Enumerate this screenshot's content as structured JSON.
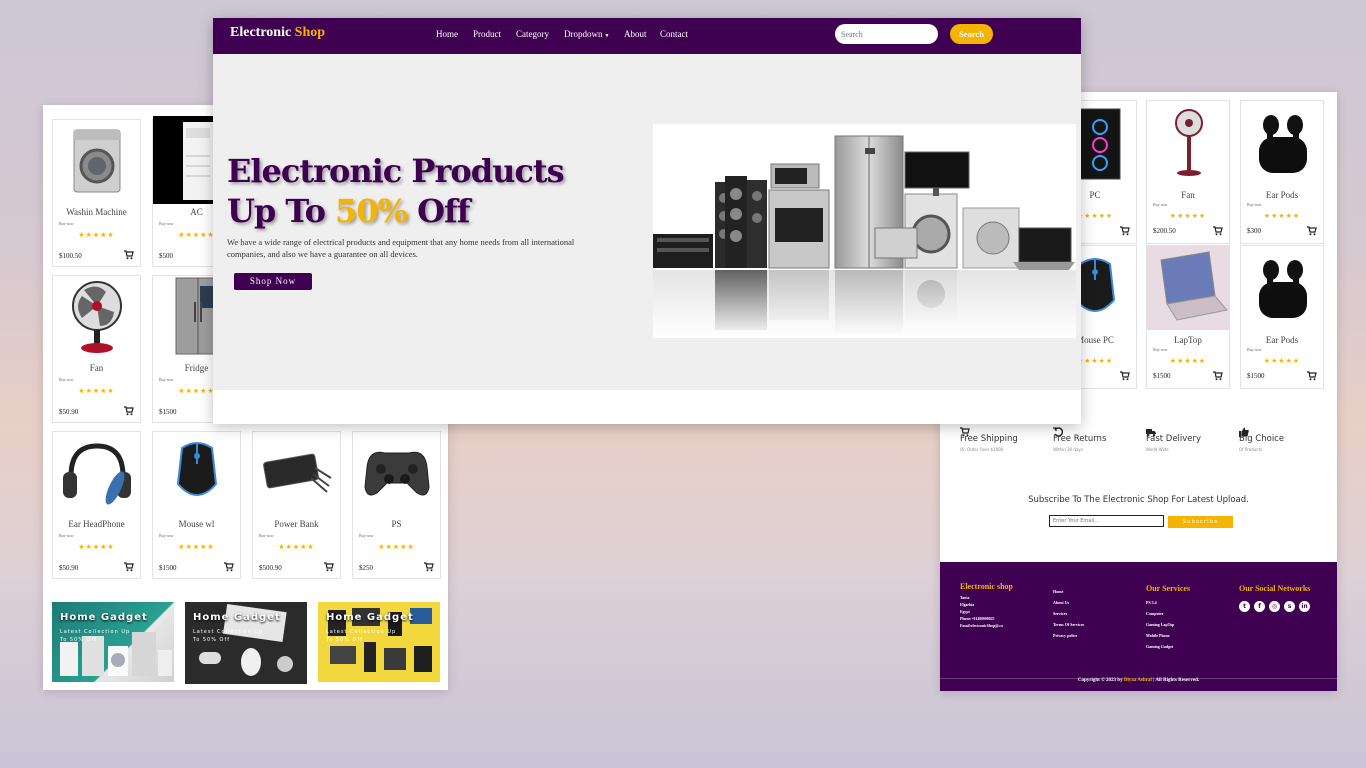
{
  "brand": {
    "first": "Electronic",
    "second": "Shop"
  },
  "nav": {
    "links": [
      "Home",
      "Product",
      "Category",
      "Dropdown",
      "About",
      "Contact"
    ],
    "search_placeholder": "Search",
    "search_button": "Search"
  },
  "hero": {
    "title_line1": "Electronic Products",
    "title_line2_prefix": "Up To",
    "title_line2_highlight": "50%",
    "title_line2_suffix": "Off",
    "description": "We have a wide range of electrical products and equipment that any home needs from all international companies, and also we have a guarantee on all devices.",
    "cta": "Shop Now"
  },
  "left_products": [
    {
      "name": "Washin Machine",
      "buy": "Buy now",
      "stars": "★★★★★",
      "price": "$100.50",
      "icon": "washing-machine"
    },
    {
      "name": "AC",
      "buy": "Buy now",
      "stars": "★★★★★",
      "price": "$500",
      "icon": "air-conditioner"
    },
    {
      "name": "Fan",
      "buy": "Buy now",
      "stars": "★★★★★",
      "price": "$50.90",
      "icon": "fan"
    },
    {
      "name": "Fridge",
      "buy": "Buy now",
      "stars": "★★★★★",
      "price": "$1500",
      "icon": "fridge"
    },
    {
      "name": "Ear HeadPhone",
      "buy": "Buy now",
      "stars": "★★★★★",
      "price": "$50.90",
      "icon": "headphones"
    },
    {
      "name": "Mouse wl",
      "buy": "Buy now",
      "stars": "★★★★★",
      "price": "$1500",
      "icon": "mouse"
    },
    {
      "name": "Power Bank",
      "buy": "Buy now",
      "stars": "★★★★★",
      "price": "$500.90",
      "icon": "power-bank"
    },
    {
      "name": "PS",
      "buy": "Buy now",
      "stars": "★★★★★",
      "price": "$250",
      "icon": "gamepad"
    }
  ],
  "gadgets": [
    {
      "title": "Home Gadget",
      "subtitle": "Latest Collection Up To 50% Off"
    },
    {
      "title": "Home Gadget",
      "subtitle": "Latest Collection Up To 50% Off"
    },
    {
      "title": "Home Gadget",
      "subtitle": "Latest Collection Up To 50% Off"
    }
  ],
  "right_products": [
    {
      "name": "PC",
      "buy": "Buy now",
      "stars": "★★★★★",
      "price": "",
      "icon": "pc"
    },
    {
      "name": "Fan",
      "buy": "Buy now",
      "stars": "★★★★★",
      "price": "$200.50",
      "icon": "stand-fan"
    },
    {
      "name": "Ear Pods",
      "buy": "Buy now",
      "stars": "★★★★★",
      "price": "$300",
      "icon": "earpods"
    },
    {
      "name": "Mouse PC",
      "buy": "Buy now",
      "stars": "★★★★★",
      "price": "",
      "icon": "mouse"
    },
    {
      "name": "LapTop",
      "buy": "Buy now",
      "stars": "★★★★★",
      "price": "$1500",
      "icon": "laptop"
    },
    {
      "name": "Ear Pods",
      "buy": "Buy now",
      "stars": "★★★★★",
      "price": "$1500",
      "icon": "earpods"
    }
  ],
  "features": [
    {
      "title": "Free Shipping",
      "subtitle": "On Order Over $1000",
      "icon": "cart-icon"
    },
    {
      "title": "Free Returns",
      "subtitle": "Within 30 days",
      "icon": "undo-icon"
    },
    {
      "title": "Fast Delivery",
      "subtitle": "World Wide",
      "icon": "truck-icon"
    },
    {
      "title": "Big Choice",
      "subtitle": "Of Products",
      "icon": "thumbs-up-icon"
    }
  ],
  "subscribe": {
    "heading": "Subscribe To The Electronic Shop For Latest Upload.",
    "placeholder": "Enter Your Email...",
    "button": "Subscribe"
  },
  "footer": {
    "col1_title": "Electronic shop",
    "col1_lines": [
      "Tanta",
      "Elgarbia",
      "Egypt",
      "Phone:+01480000025",
      "Email:electronicShop@.co"
    ],
    "col2_lines": [
      "Home",
      "About Us",
      "Services",
      "Terms Of Services",
      "Privacy police"
    ],
    "col3_title": "Our Services",
    "col3_lines": [
      "PS 5.4",
      "Computer",
      "Gaming LapTop",
      "Mobile Phone",
      "Gaming Gadget"
    ],
    "col4_title": "Our Social Networks",
    "social_icons": [
      "twitter-icon",
      "facebook-icon",
      "instagram-icon",
      "skype-icon",
      "linkedin-icon"
    ],
    "copyright_prefix": "Copyright © 2023 by",
    "copyright_name": "Diyaa Ashraf",
    "copyright_suffix": "| All Rights Reserved."
  },
  "colors": {
    "brand_purple": "#3f0051",
    "accent_yellow": "#f4b400"
  }
}
